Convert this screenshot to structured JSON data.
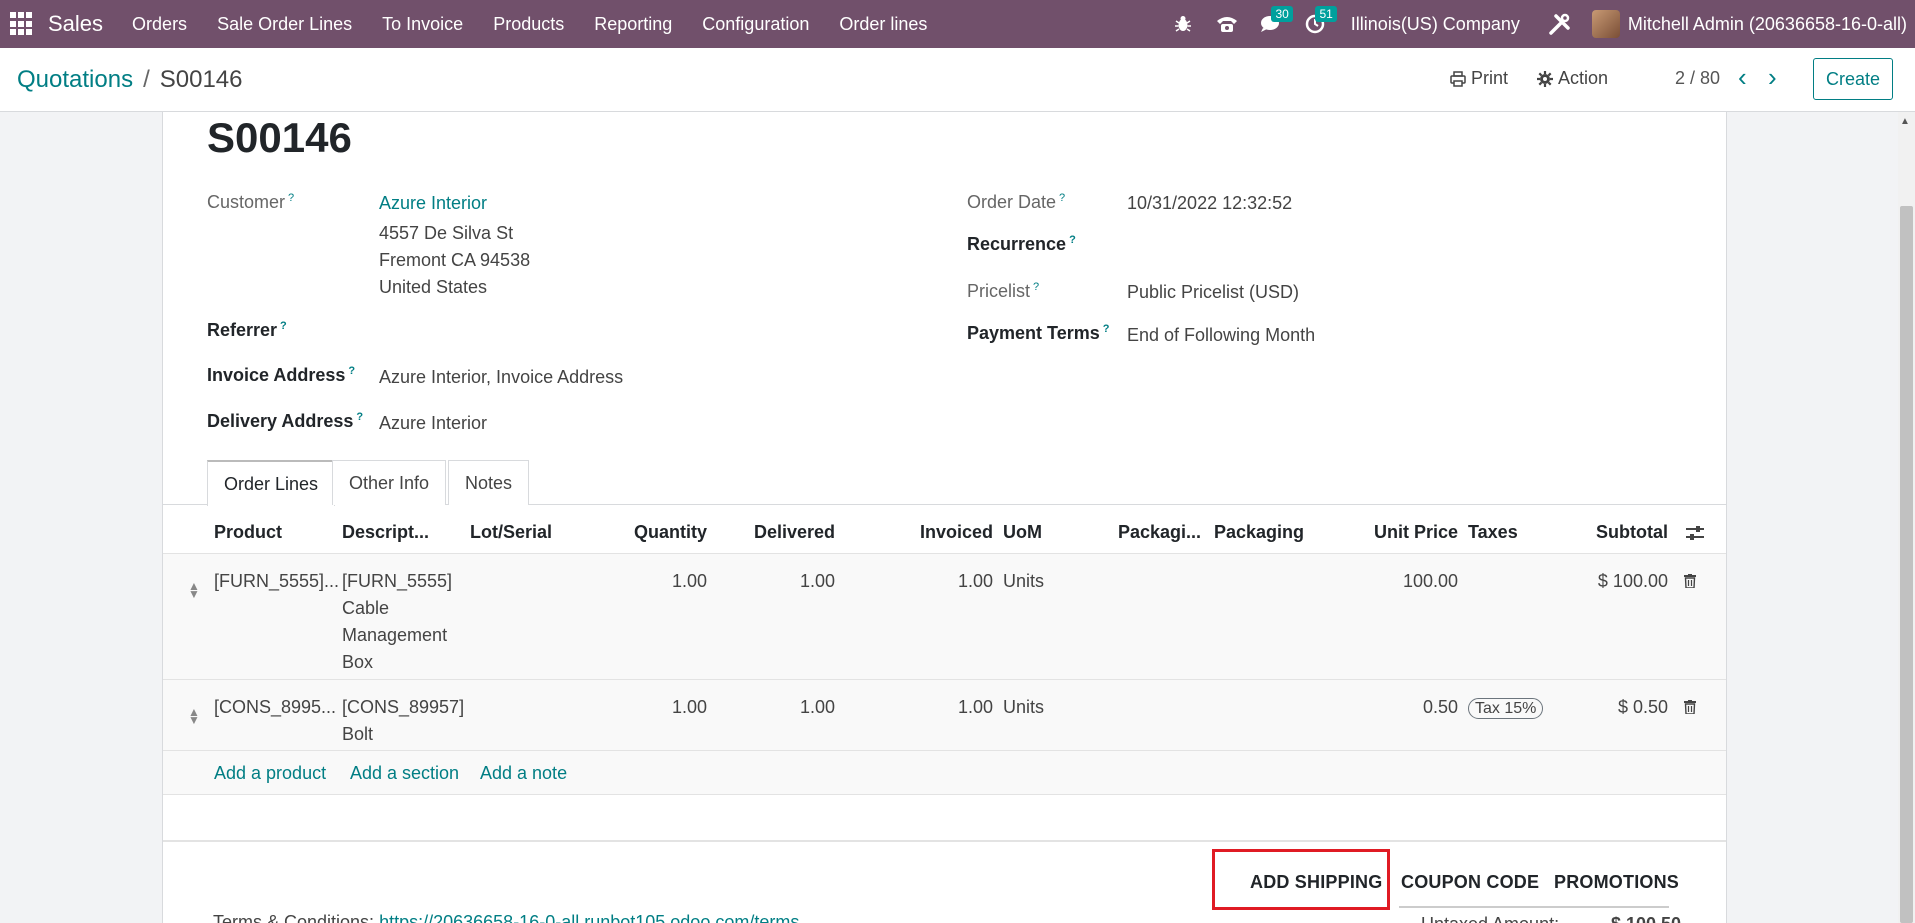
{
  "navbar": {
    "app_name": "Sales",
    "menu": [
      "Orders",
      "Sale Order Lines",
      "To Invoice",
      "Products",
      "Reporting",
      "Configuration",
      "Order lines"
    ],
    "messages_count": "30",
    "activities_count": "51",
    "company": "Illinois(US) Company",
    "user": "Mitchell Admin (20636658-16-0-all)",
    "icons": [
      "apps-grid-icon",
      "bug-icon",
      "phone-icon",
      "chat-icon",
      "clock-icon",
      "tools-icon"
    ]
  },
  "control": {
    "breadcrumb_parent": "Quotations",
    "breadcrumb_sep": "/",
    "breadcrumb_current": "S00146",
    "print_label": "Print",
    "action_label": "Action",
    "pager": "2 / 80",
    "create_label": "Create"
  },
  "form": {
    "title": "S00146",
    "customer_label": "Customer",
    "customer_name": "Azure Interior",
    "customer_addr1": "4557 De Silva St",
    "customer_addr2": "Fremont CA 94538",
    "customer_addr3": "United States",
    "referrer_label": "Referrer",
    "invoice_address_label": "Invoice Address",
    "invoice_address": "Azure Interior, Invoice Address",
    "delivery_address_label": "Delivery Address",
    "delivery_address": "Azure Interior",
    "order_date_label": "Order Date",
    "order_date": "10/31/2022 12:32:52",
    "recurrence_label": "Recurrence",
    "pricelist_label": "Pricelist",
    "pricelist": "Public Pricelist (USD)",
    "payment_terms_label": "Payment Terms",
    "payment_terms": "End of Following Month",
    "help_mark": "?"
  },
  "tabs": [
    "Order Lines",
    "Other Info",
    "Notes"
  ],
  "table": {
    "headers": {
      "product": "Product",
      "description": "Descript...",
      "lot": "Lot/Serial",
      "quantity": "Quantity",
      "delivered": "Delivered",
      "invoiced": "Invoiced",
      "uom": "UoM",
      "packaging1": "Packagi...",
      "packaging2": "Packaging",
      "unit_price": "Unit Price",
      "taxes": "Taxes",
      "subtotal": "Subtotal"
    },
    "rows": [
      {
        "product": "[FURN_5555]...",
        "description": [
          "[FURN_5555]",
          "Cable",
          "Management",
          "Box"
        ],
        "quantity": "1.00",
        "delivered": "1.00",
        "invoiced": "1.00",
        "uom": "Units",
        "unit_price": "100.00",
        "tax": "",
        "subtotal": "$ 100.00"
      },
      {
        "product": "[CONS_8995...",
        "description": [
          "[CONS_89957]",
          "Bolt"
        ],
        "quantity": "1.00",
        "delivered": "1.00",
        "invoiced": "1.00",
        "uom": "Units",
        "unit_price": "0.50",
        "tax": "Tax 15%",
        "subtotal": "$ 0.50"
      }
    ],
    "add_product": "Add a product",
    "add_section": "Add a section",
    "add_note": "Add a note"
  },
  "actions": {
    "add_shipping": "ADD SHIPPING",
    "coupon_code": "COUPON CODE",
    "promotions": "PROMOTIONS"
  },
  "footer": {
    "terms_label": "Terms & Conditions:",
    "terms_link": "https://20636658-16-0-all.runbot105.odoo.com/terms",
    "untaxed_label": "Untaxed Amount:",
    "untaxed_value": "$ 100.50"
  },
  "colors": {
    "navbar": "#71506b",
    "accent": "#017e84",
    "badge": "#00a09d",
    "highlight": "#e01b24"
  }
}
